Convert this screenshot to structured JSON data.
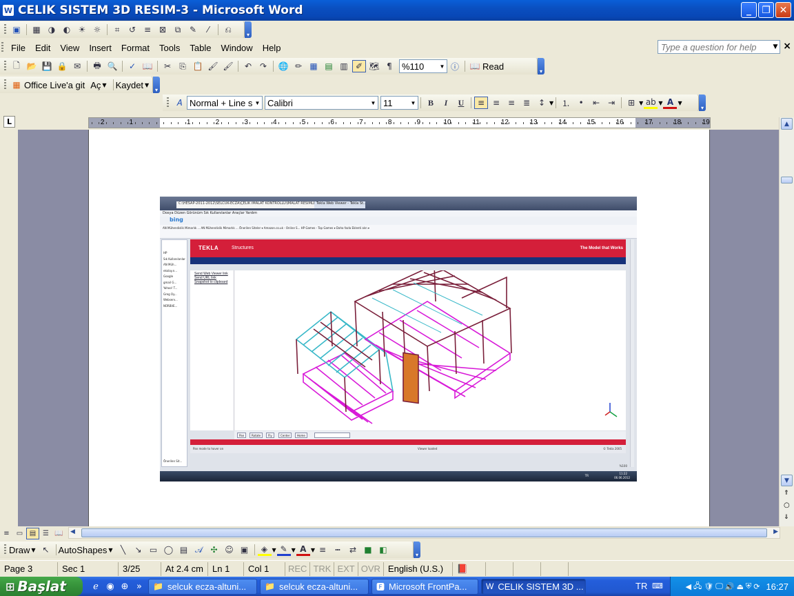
{
  "window": {
    "title": "CELIK SISTEM 3D RESIM-3 - Microsoft Word",
    "app_icon": "W",
    "controls": {
      "minimize": "_",
      "maximize": "❐",
      "close": "✕"
    }
  },
  "menubar": {
    "items": [
      "File",
      "Edit",
      "View",
      "Insert",
      "Format",
      "Tools",
      "Table",
      "Window",
      "Help"
    ],
    "help_placeholder": "Type a question for help",
    "close": "×"
  },
  "standard_toolbar": {
    "zoom": "%110",
    "read_label": "Read"
  },
  "office_live_toolbar": {
    "goto_label": "Office Live'a git",
    "open_label": "Aç",
    "save_label": "Kaydet"
  },
  "formatting_toolbar": {
    "style": "Normal + Line sp",
    "font": "Calibri",
    "size": "11",
    "bold": "B",
    "italic": "I",
    "underline": "U"
  },
  "ruler": {
    "tab_selector": "L",
    "numbers": [
      "2",
      "1",
      "1",
      "2",
      "3",
      "4",
      "5",
      "6",
      "7",
      "8",
      "9",
      "10",
      "11",
      "12",
      "13",
      "14",
      "15",
      "16",
      "17",
      "18",
      "19"
    ]
  },
  "embedded_screenshot": {
    "address": "C:\\HESAP-2011-2012\\SELCUK-ECZA\\ÇELİK İMALAT KONTROLLU\\İMALAT RESİMLERİ",
    "tab": "Tekla Web Viewer - Tekla St...",
    "browser_menu": "Dosya   Düzen   Görünüm   Sık Kullanılanlar   Araçlar   Yardım",
    "bing": "bing",
    "favorites": "AN Mühendislik Mimarlık ...   AN Mühendislik Mimarlık ...   Önerilen Siteler ▾   Amazon.co.uk - Online S...   HP Games - Top Games ▾   Daha fazla Eklenti alın ▾",
    "sidebar_items": [
      "HP",
      "Sık Kullanılanlar",
      "AN Müh...",
      "ekolay.n...",
      "Google",
      "gmail G...",
      "Yahoo! T...",
      "Greg Oy...",
      "Webserv...",
      "NÜRBVE..."
    ],
    "tekla_logo": "TEKLA",
    "tekla_product": "Structures",
    "tekla_tagline": "The Model that Works",
    "links": [
      "Send Web Viewer link",
      "Send URL link",
      "Snapshot to clipboard"
    ],
    "view_buttons": [
      "Pan",
      "Rotate",
      "Fly",
      "Center",
      "Home"
    ],
    "status_left": "Pan mode to hover on",
    "status_mid": "Viewer loaded",
    "status_right": "© Tekla 2005",
    "zoom": "%100",
    "sidebar_footer": "Önerilen Sit...",
    "clock_time": "11:22",
    "clock_date": "06.06.2012",
    "lang": "TR"
  },
  "drawing_toolbar": {
    "draw_label": "Draw",
    "autoshapes_label": "AutoShapes"
  },
  "statusbar": {
    "page": "Page 3",
    "section": "Sec 1",
    "page_of": "3/25",
    "at": "At 2.4 cm",
    "line": "Ln 1",
    "col": "Col 1",
    "rec": "REC",
    "trk": "TRK",
    "ext": "EXT",
    "ovr": "OVR",
    "language": "English (U.S.)"
  },
  "taskbar": {
    "start_label": "Başlat",
    "tasks": [
      "selcuk ecza-altuni...",
      "selcuk ecza-altuni...",
      "Microsoft FrontPa...",
      "CELIK SISTEM 3D ..."
    ],
    "lang": "TR",
    "clock": "16:27"
  },
  "colors": {
    "title_blue": "#0a4fc0",
    "tekla_red": "#d41f3a",
    "tekla_navy": "#17327a",
    "steel_maroon": "#7a1f3a",
    "steel_magenta": "#d81ad8",
    "steel_cyan": "#38b8c8"
  }
}
